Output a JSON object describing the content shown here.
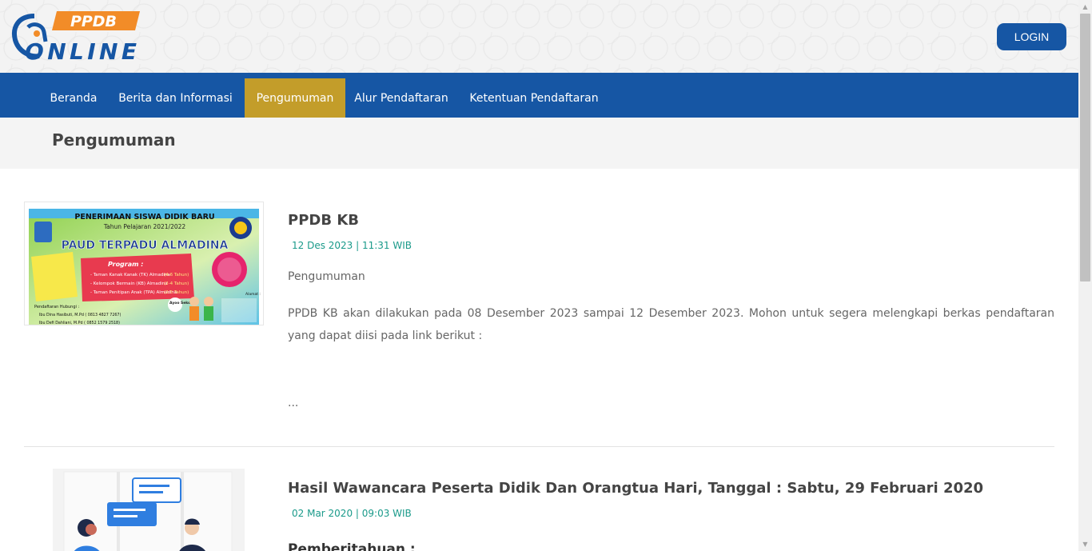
{
  "header": {
    "logo_text_top": "PPDB",
    "logo_text_bottom": "ONLINE",
    "login_label": "LOGIN"
  },
  "nav": {
    "items": [
      {
        "label": "Beranda"
      },
      {
        "label": "Berita dan Informasi"
      },
      {
        "label": "Pengumuman",
        "active": true
      },
      {
        "label": "Alur Pendaftaran"
      },
      {
        "label": "Ketentuan Pendaftaran"
      }
    ]
  },
  "page": {
    "title": "Pengumuman"
  },
  "posts": [
    {
      "title": "PPDB KB",
      "date": "12 Des 2023 | 11:31 WIB",
      "category": "Pengumuman",
      "body": "PPDB KB akan dilakukan pada 08 Desember 2023 sampai 12 Desember 2023.  Mohon untuk segera melengkapi berkas pendaftaran yang dapat diisi pada link berikut :",
      "ellipsis": "...",
      "image": {
        "headline": "PENERIMAAN SISWA DIDIK BARU",
        "subline": "Tahun Pelajaran 2021/2022",
        "school": "PAUD TERPADU ALMADINA",
        "program_title": "Program :",
        "program_lines": [
          "- Taman Kanak Kanak (TK) Almadina",
          "- Kelompok Bermain (KB) Almadina",
          "- Taman Penitipan Anak (TPA) Almadina"
        ],
        "age_lines": [
          "(4-6 Tahun)",
          "(2-4 Tahun)",
          "(2-5 Tahun)"
        ],
        "contact_label": "Pendaftaran Hubungi :",
        "contact_lines": [
          "Ibu Dina Hasibuti, M.Pd ( 0813 4827 7267)",
          "Ibu Defi Dahliani, M.Pd ( 0852 1579 2518)"
        ],
        "address_label": "Alamat :",
        "badge": "Ayoo Sekolah"
      }
    },
    {
      "title": "Hasil Wawancara Peserta Didik Dan Orangtua Hari, Tanggal : Sabtu, 29 Februari 2020",
      "date": "02 Mar 2020 | 09:03 WIB",
      "subheading": "Pemberitahuan :"
    }
  ],
  "colors": {
    "primary": "#1656a4",
    "accent": "#c39d2a",
    "date": "#1a9a8a",
    "logo_orange": "#f28c28"
  }
}
